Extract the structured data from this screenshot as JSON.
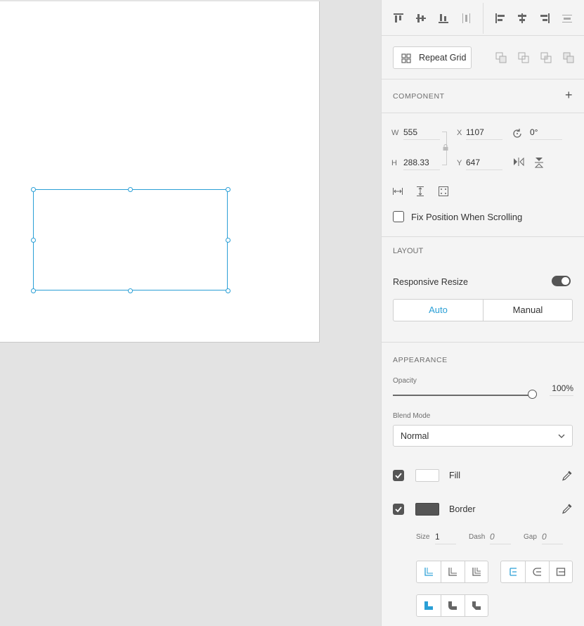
{
  "toolbar": {
    "align_icons": [
      "align-top-icon",
      "align-middle-icon",
      "align-bottom-icon",
      "distribute-vertical-icon",
      "align-left-icon",
      "align-center-icon",
      "align-right-icon",
      "distribute-horizontal-icon"
    ],
    "repeat_grid_label": "Repeat Grid"
  },
  "component": {
    "title": "COMPONENT",
    "add_symbol": "+"
  },
  "transform": {
    "w_label": "W",
    "w_value": "555",
    "h_label": "H",
    "h_value": "288.33",
    "x_label": "X",
    "x_value": "1107",
    "y_label": "Y",
    "y_value": "647",
    "rotation_value": "0°",
    "fix_position_label": "Fix Position When Scrolling"
  },
  "layout": {
    "title": "LAYOUT",
    "responsive_label": "Responsive Resize",
    "responsive_on": true,
    "auto_label": "Auto",
    "manual_label": "Manual"
  },
  "appearance": {
    "title": "APPEARANCE",
    "opacity_label": "Opacity",
    "opacity_value": "100%",
    "opacity_fraction": 1.0,
    "blend_label": "Blend Mode",
    "blend_value": "Normal",
    "fill_label": "Fill",
    "fill_color": "#ffffff",
    "border_label": "Border",
    "border_color": "#555555",
    "size_label": "Size",
    "size_value": "1",
    "dash_label": "Dash",
    "dash_value": "0",
    "gap_label": "Gap",
    "gap_value": "0"
  },
  "colors": {
    "accent": "#2a9fd6",
    "selection": "#2a9fd6"
  }
}
